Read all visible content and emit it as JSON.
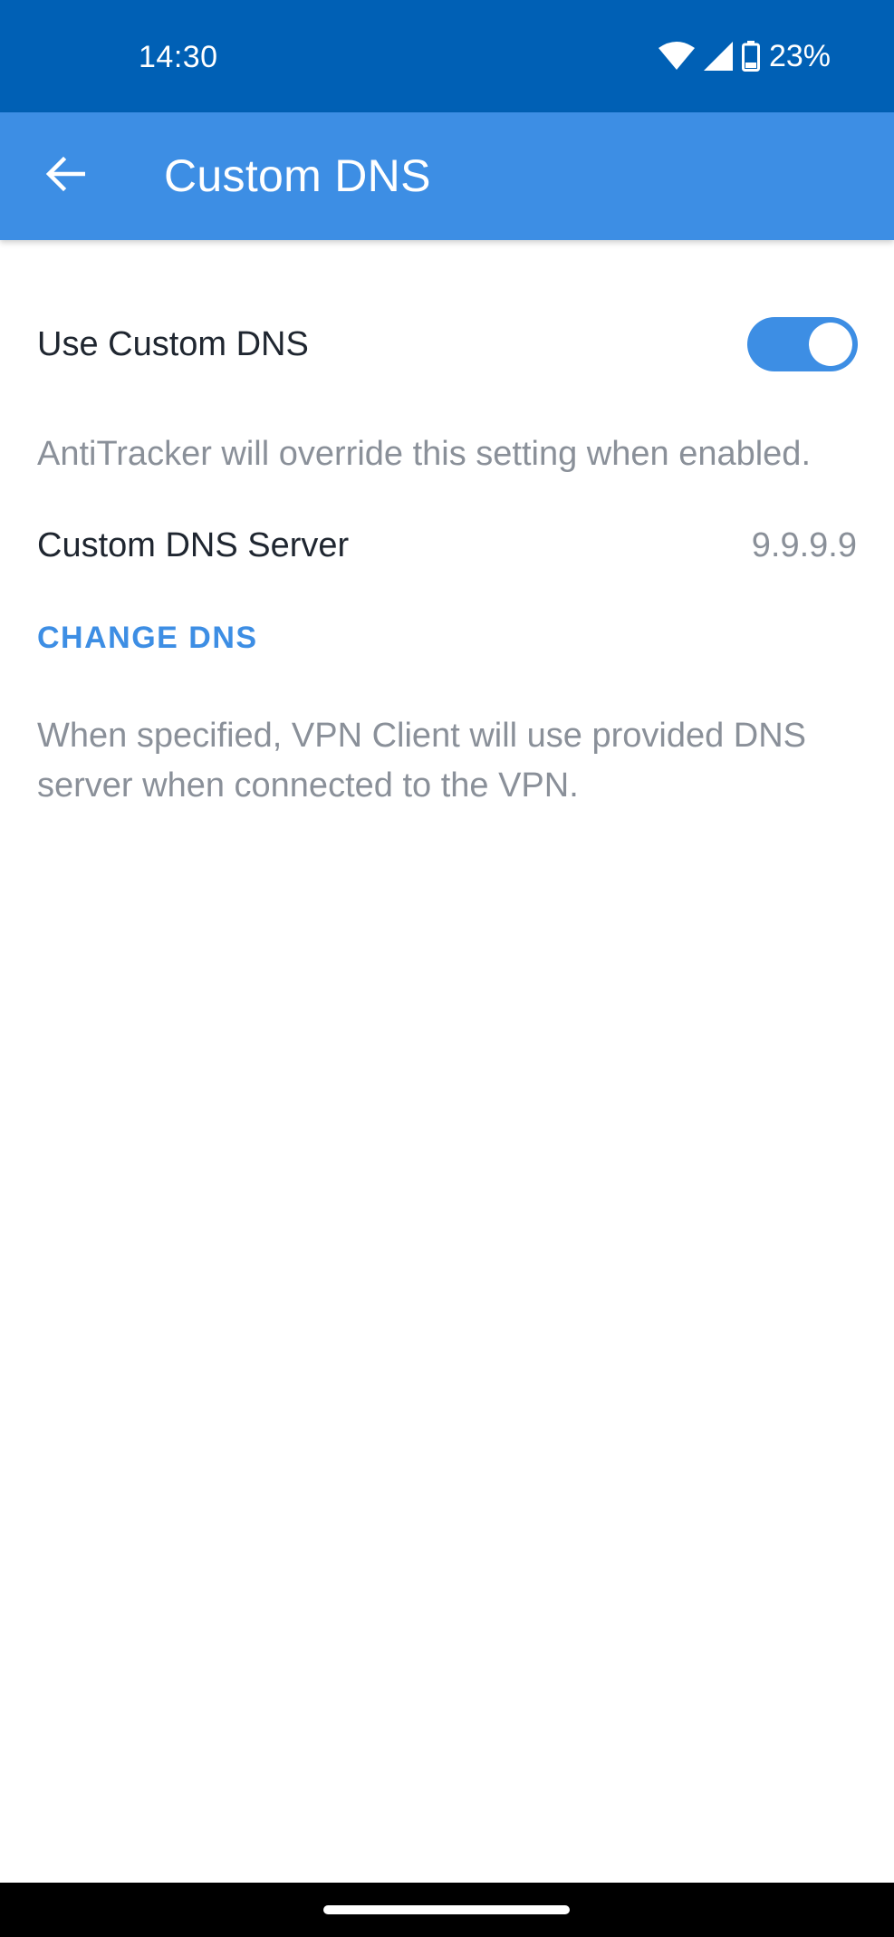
{
  "status_bar": {
    "time": "14:30",
    "battery_percent": "23%",
    "icons": [
      "wifi-icon",
      "cellular-signal-icon",
      "battery-icon"
    ]
  },
  "app_bar": {
    "title": "Custom DNS",
    "back_icon": "arrow-back-icon"
  },
  "settings": {
    "use_custom_dns": {
      "label": "Use Custom DNS",
      "enabled": true
    },
    "antitracker_note": "AntiTracker will override this setting when enabled.",
    "server": {
      "label": "Custom DNS Server",
      "value": "9.9.9.9"
    },
    "change_button_label": "CHANGE DNS",
    "description": "When specified, VPN Client will use provided DNS server when connected to the VPN."
  },
  "colors": {
    "status_bar": "#0060b5",
    "app_bar": "#3d8ee4",
    "accent": "#3d8ee4",
    "primary_text": "#1f2630",
    "secondary_text": "#8a9099"
  }
}
